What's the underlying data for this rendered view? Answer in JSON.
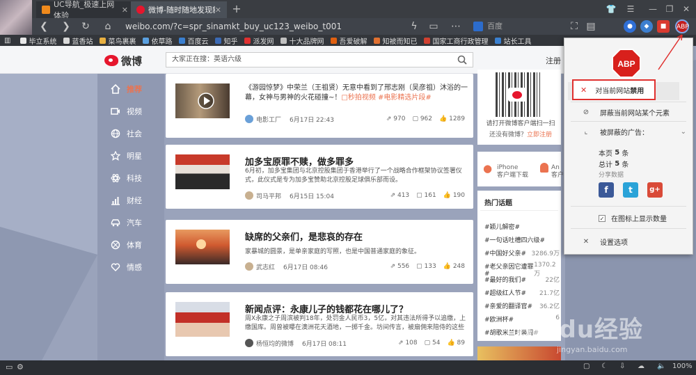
{
  "browser": {
    "tabs": [
      {
        "label": "UC导航_极速上网体验",
        "active": false
      },
      {
        "label": "微博-随时随地发现新",
        "active": true
      }
    ],
    "url": "weibo.com/?c=spr_sinamkt_buy_uc123_weibo_t001",
    "search_engine": "百度",
    "bookmarks": [
      "毕立系统",
      "蓝香站",
      "菜鸟裹裹",
      "依草路",
      "百度云",
      "知乎",
      "派发网",
      "十大品牌网",
      "吾爱破解",
      "知被而知已",
      "国家工商行政管理",
      "站长工具"
    ],
    "bookmark_colors": [
      "#e8e8e8",
      "#d9d9d9",
      "#e8b040",
      "#5aa0e0",
      "#3a7fd0",
      "#3b6ab5",
      "#e03030",
      "#c0c0c0",
      "#e06010",
      "#e07030",
      "#d04030",
      "#3a80d0"
    ],
    "zoom": "100%"
  },
  "weibo": {
    "logo_text": "微博",
    "search_placeholder": "大家正在搜：英语六级",
    "register": "注册",
    "nav": [
      {
        "label": "推荐",
        "icon": "home-icon",
        "active": true
      },
      {
        "label": "视频",
        "icon": "video-icon",
        "active": false
      },
      {
        "label": "社会",
        "icon": "globe-icon",
        "active": false
      },
      {
        "label": "明星",
        "icon": "star-icon",
        "active": false
      },
      {
        "label": "科技",
        "icon": "atom-icon",
        "active": false
      },
      {
        "label": "财经",
        "icon": "chart-icon",
        "active": false
      },
      {
        "label": "汽车",
        "icon": "car-icon",
        "active": false
      },
      {
        "label": "体育",
        "icon": "ball-icon",
        "active": false
      },
      {
        "label": "情感",
        "icon": "heart-icon",
        "active": false
      }
    ],
    "feed": [
      {
        "title": "",
        "desc_main": "《游园惊梦》中荣兰（王祖贤）无意中看到了邢志刚（吴彦祖）沐浴的一幕，女神与男神的火花碰撞~！",
        "desc_tag": "□秒拍视频 #电影精选片段#",
        "author": "电影工厂",
        "time": "6月17日 22:43",
        "shares": "970",
        "comments": "962",
        "likes": "1289"
      },
      {
        "title": "加多宝原罪不赎，做多罪多",
        "desc_main": "6月初，加多宝集团与北京控股集团于香港举行了一个战略合作框架协议签署仪式，此仪式是专为加多宝赞助北京控股足球俱乐部而设。",
        "desc_tag": "",
        "author": "司马平邦",
        "time": "6月15日 15:04",
        "shares": "413",
        "comments": "161",
        "likes": "190"
      },
      {
        "title": "缺席的父亲们，是悲哀的存在",
        "desc_main": "家暴城的圆景，是单亲家庭的写照，也是中国普通家庭的象征。",
        "desc_tag": "",
        "author": "武志红",
        "time": "6月17日 08:46",
        "shares": "556",
        "comments": "133",
        "likes": "248"
      },
      {
        "title": "新闻点评：永康儿子的钱都花在哪儿了？",
        "desc_main": "周X永康之子周滨被判18年，处罚金人民币3，5亿，对其违法所得予以追缴，上缴国库。周曾被曝在澳洲花天酒地，一掷千金。坊间传言，被扇佣来陪侍的这些",
        "desc_tag": "",
        "author": "杨恒均的微博",
        "time": "6月17日 08:11",
        "shares": "108",
        "comments": "54",
        "likes": "89"
      }
    ],
    "qr_caption": "请打开微博客户端扫一扫",
    "login_prefix": "还没有微博？",
    "login_link": "立即注册",
    "apps": [
      {
        "label": "iPhone",
        "sub": "客户端下载"
      },
      {
        "label": "An",
        "sub": "客户"
      }
    ],
    "hot_title": "热门话题",
    "hot_topics": [
      {
        "name": "#颖儿解密#",
        "count": ""
      },
      {
        "name": "#一句话吐槽四六级#",
        "count": ""
      },
      {
        "name": "#中国好父亲#",
        "count": "3286.9万"
      },
      {
        "name": "#老父亲因它遭罪#",
        "count": "1370.2万"
      },
      {
        "name": "#最好的我们#",
        "count": "22亿"
      },
      {
        "name": "#超级红人节#",
        "count": "21.7亿"
      },
      {
        "name": "#亲爱的翻译官#",
        "count": "36.2亿"
      },
      {
        "name": "#欧洲杯#",
        "count": "6"
      },
      {
        "name": "#胡歌米兰时装周#",
        "count": ""
      }
    ]
  },
  "abp": {
    "logo": "ABP",
    "disable_prefix": "对当前网站",
    "disable_bold": "禁用",
    "block_element": "屏蔽当前网站某个元素",
    "blocked_header": "被屏蔽的广告：",
    "this_page_prefix": "本页",
    "this_page_count": "5",
    "this_page_unit": "条",
    "total_prefix": "总计",
    "total_count": "5",
    "total_unit": "条",
    "share": "分享数据",
    "show_count": "在图标上显示数量",
    "settings": "设置选项"
  },
  "watermark": {
    "brand": "Baidu经验",
    "url": "jingyan.baidu.com"
  }
}
